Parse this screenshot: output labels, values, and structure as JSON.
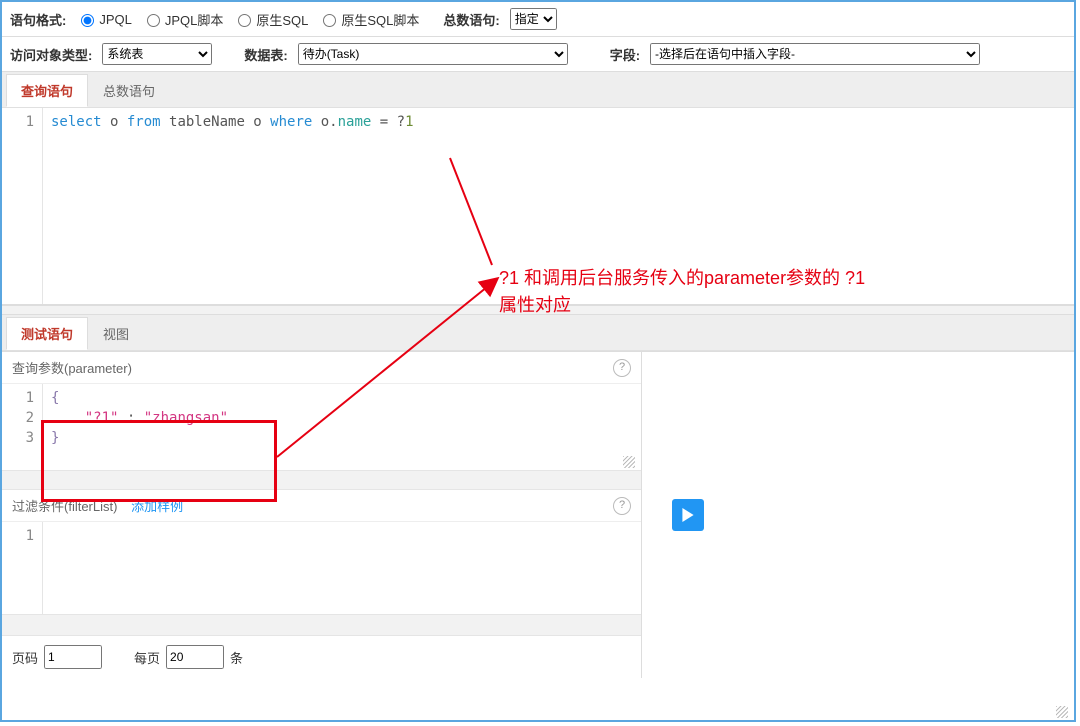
{
  "row1": {
    "format_label": "语句格式:",
    "radios": {
      "jpql": "JPQL",
      "jpql_script": "JPQL脚本",
      "native_sql": "原生SQL",
      "native_sql_script": "原生SQL脚本"
    },
    "selected_radio": "jpql",
    "total_label": "总数语句:",
    "total_select": "指定"
  },
  "row2": {
    "object_type_label": "访问对象类型:",
    "object_type_value": "系统表",
    "data_table_label": "数据表:",
    "data_table_value": "待办(Task)",
    "field_label": "字段:",
    "field_value": "-选择后在语句中插入字段-"
  },
  "top_tabs": {
    "query": "查询语句",
    "total": "总数语句"
  },
  "query_sql": {
    "tokens": [
      {
        "t": "select",
        "c": "kw"
      },
      {
        "t": " o ",
        "c": "plain"
      },
      {
        "t": "from",
        "c": "kw"
      },
      {
        "t": " tableName o ",
        "c": "plain"
      },
      {
        "t": "where",
        "c": "kw"
      },
      {
        "t": " o.",
        "c": "plain"
      },
      {
        "t": "name",
        "c": "prop"
      },
      {
        "t": " = ?",
        "c": "plain"
      },
      {
        "t": "1",
        "c": "num"
      }
    ]
  },
  "mid_tabs": {
    "test": "测试语句",
    "view": "视图"
  },
  "param_section": {
    "title": "查询参数(parameter)",
    "lines": [
      [
        {
          "t": "{",
          "c": "brace"
        }
      ],
      [
        {
          "t": "    ",
          "c": "plain"
        },
        {
          "t": "\"?1\"",
          "c": "str"
        },
        {
          "t": " : ",
          "c": "plain"
        },
        {
          "t": "\"zhangsan\"",
          "c": "str"
        }
      ],
      [
        {
          "t": "}",
          "c": "brace"
        }
      ]
    ]
  },
  "filter_section": {
    "title": "过滤条件(filterList)",
    "add_example": "添加样例"
  },
  "footer": {
    "page_label": "页码",
    "page_value": "1",
    "per_label": "每页",
    "per_value": "20",
    "unit": "条"
  },
  "annotation": {
    "line1": "?1 和调用后台服务传入的parameter参数的 ?1",
    "line2": "属性对应"
  }
}
